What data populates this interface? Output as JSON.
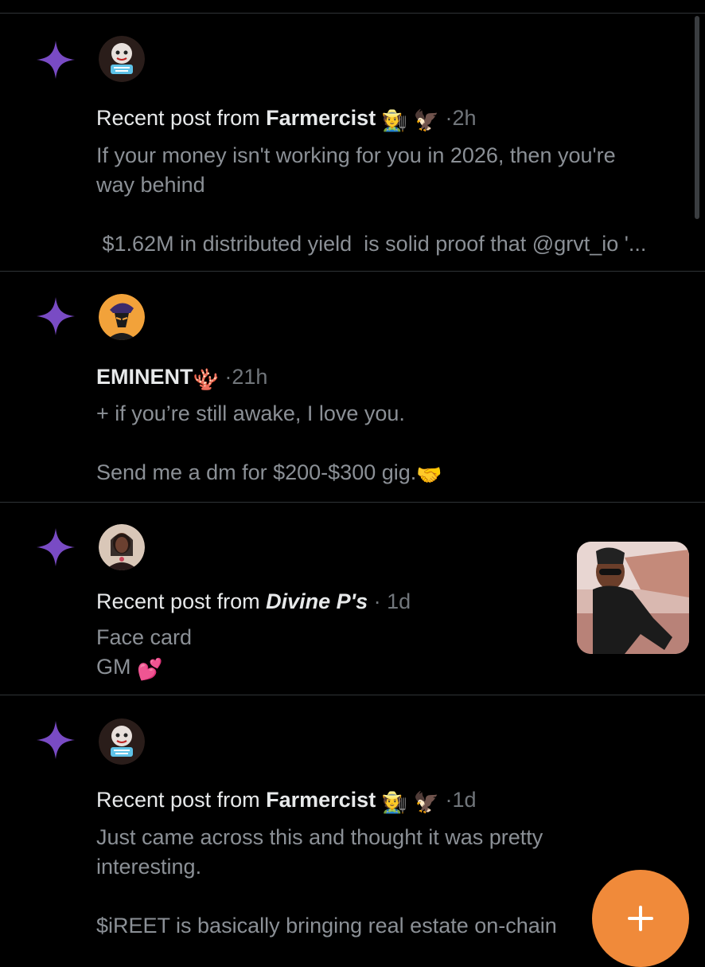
{
  "colors": {
    "background": "#000000",
    "accent_star": "#794bc4",
    "fab": "#f08a3a",
    "divider": "#2f3336",
    "muted_text": "#8b9096"
  },
  "notifications": [
    {
      "type": "recent-post",
      "prefix": "Recent post from",
      "author": "Farmercist",
      "emojis": [
        "🧑‍🌾",
        "🦅"
      ],
      "separator": "·",
      "time": "2h",
      "lines": [
        "If your money isn't working for you in 2026, then you're",
        "way behind",
        "",
        " $1.62M in distributed yield  is solid proof that @grvt_io '..."
      ],
      "icon": "sparkle-star-icon"
    },
    {
      "type": "post",
      "author": "EMINENT",
      "emojis": [
        "🪸"
      ],
      "separator": "·",
      "time": "21h",
      "lines": [
        "+ if you’re still awake, I love you.",
        "",
        "Send me a dm for $200-$300 gig."
      ],
      "trailing_emoji": "🤝",
      "icon": "sparkle-star-icon"
    },
    {
      "type": "recent-post",
      "prefix": "Recent post from",
      "author": "Divine P's",
      "separator": "·",
      "time": "1d",
      "lines": [
        "Face card",
        "GM"
      ],
      "trailing_emoji": "💕",
      "has_thumbnail": true,
      "icon": "sparkle-star-icon"
    },
    {
      "type": "recent-post",
      "prefix": "Recent post from",
      "author": "Farmercist",
      "emojis": [
        "🧑‍🌾",
        "🦅"
      ],
      "separator": "·",
      "time": "1d",
      "lines": [
        "Just came across this and thought it was pretty",
        "interesting.",
        "",
        "$iREET is basically bringing real estate on-chain"
      ],
      "icon": "sparkle-star-icon"
    }
  ],
  "fab": {
    "icon": "plus-icon"
  }
}
